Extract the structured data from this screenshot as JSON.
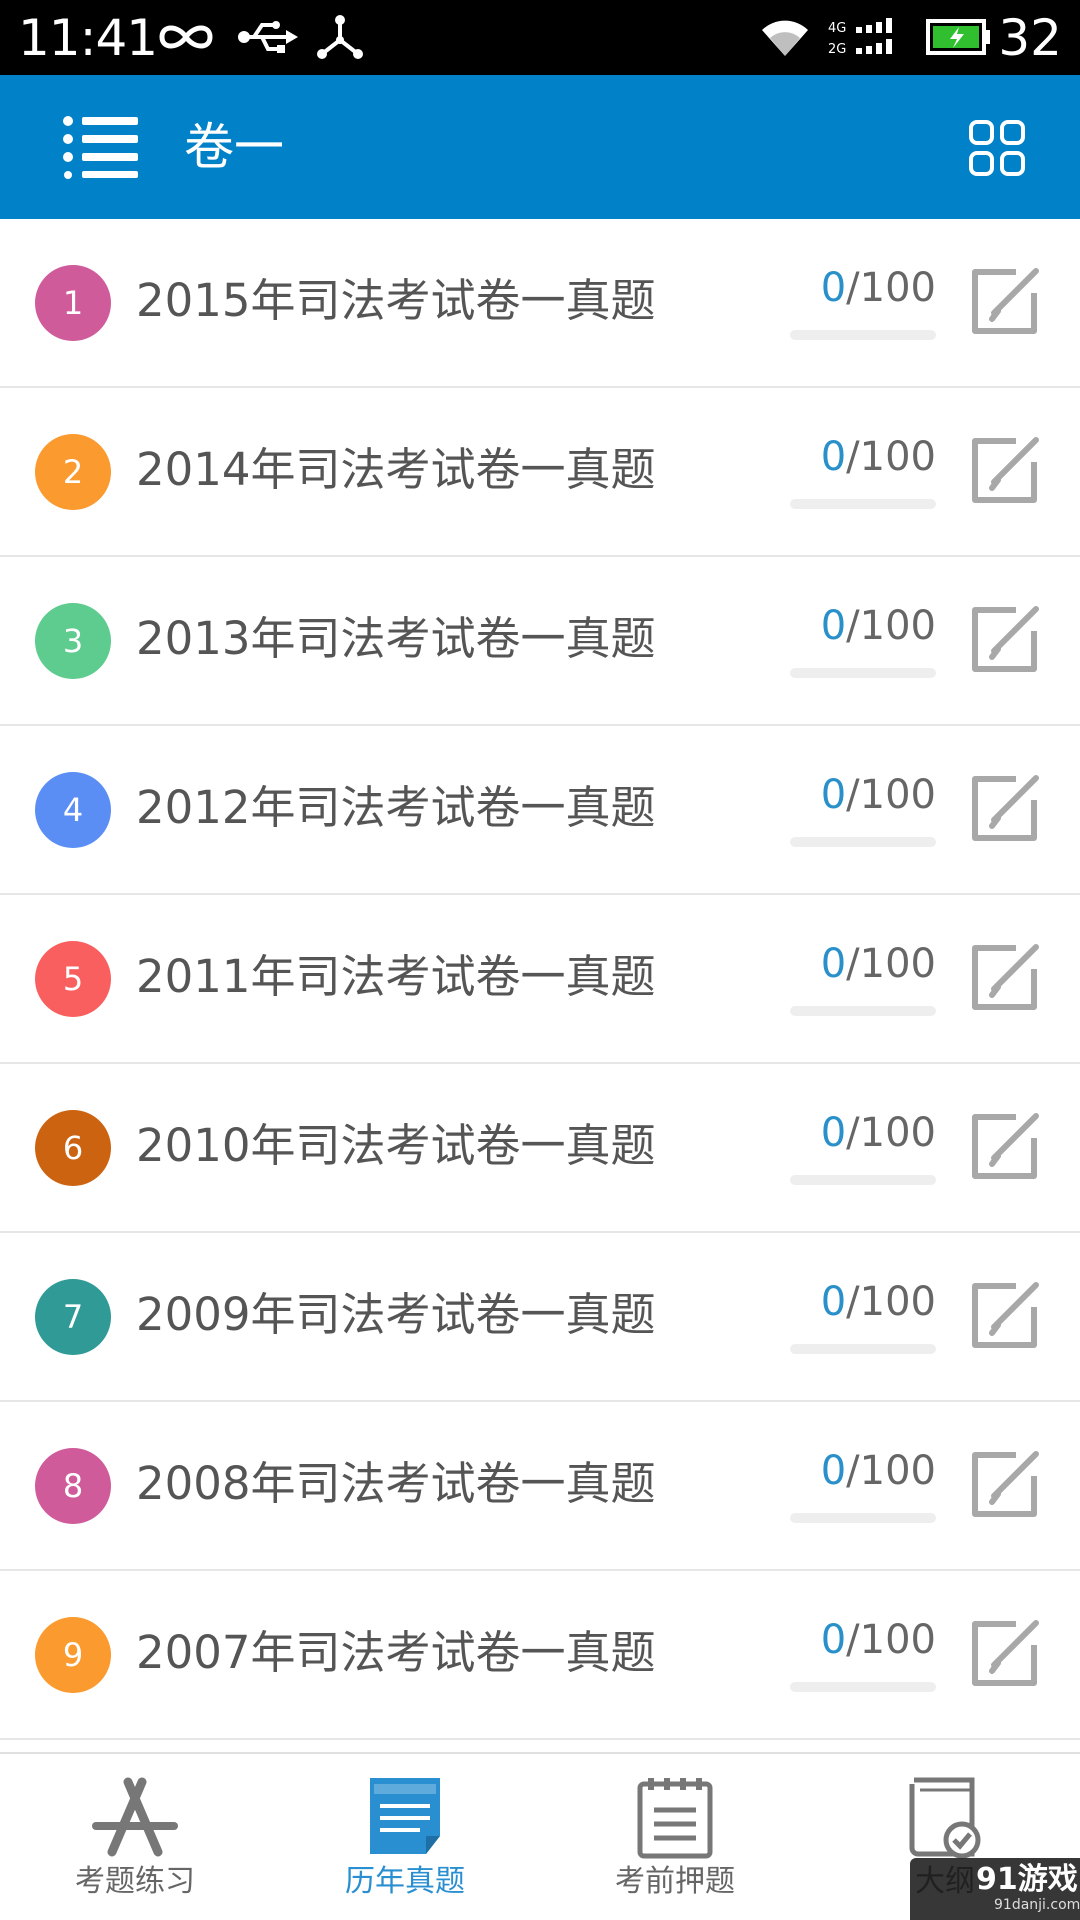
{
  "status_bar": {
    "time": "11:41",
    "battery_level": "32",
    "network_labels": [
      "4G",
      "2G"
    ]
  },
  "app_bar": {
    "title": "卷一",
    "color": "#0081c8"
  },
  "papers": [
    {
      "index": "1",
      "title": "2015年司法考试卷一真题",
      "got": "0",
      "total": "/100",
      "progress": 0,
      "color": "#cf5b9b"
    },
    {
      "index": "2",
      "title": "2014年司法考试卷一真题",
      "got": "0",
      "total": "/100",
      "progress": 0,
      "color": "#fb9a2f"
    },
    {
      "index": "3",
      "title": "2013年司法考试卷一真题",
      "got": "0",
      "total": "/100",
      "progress": 0,
      "color": "#5ecb8f"
    },
    {
      "index": "4",
      "title": "2012年司法考试卷一真题",
      "got": "0",
      "total": "/100",
      "progress": 0,
      "color": "#5b8ef5"
    },
    {
      "index": "5",
      "title": "2011年司法考试卷一真题",
      "got": "0",
      "total": "/100",
      "progress": 0,
      "color": "#fa5f5f"
    },
    {
      "index": "6",
      "title": "2010年司法考试卷一真题",
      "got": "0",
      "total": "/100",
      "progress": 0,
      "color": "#cc6310"
    },
    {
      "index": "7",
      "title": "2009年司法考试卷一真题",
      "got": "0",
      "total": "/100",
      "progress": 0,
      "color": "#2f9a96"
    },
    {
      "index": "8",
      "title": "2008年司法考试卷一真题",
      "got": "0",
      "total": "/100",
      "progress": 0,
      "color": "#cf5b9b"
    },
    {
      "index": "9",
      "title": "2007年司法考试卷一真题",
      "got": "0",
      "total": "/100",
      "progress": 0,
      "color": "#fb9a2f"
    }
  ],
  "tabs": [
    {
      "label": "考题练习",
      "icon": "app-store-icon",
      "active": false
    },
    {
      "label": "历年真题",
      "icon": "document-icon",
      "active": true
    },
    {
      "label": "考前押题",
      "icon": "notepad-icon",
      "active": false
    },
    {
      "label": "大纲",
      "icon": "book-check-icon",
      "active": false
    }
  ],
  "watermark": {
    "logo": "91游戏",
    "site": "91danji.com"
  },
  "colors": {
    "accent": "#2a8fd0",
    "score": "#2a90c9",
    "icon_gray": "#999999"
  }
}
